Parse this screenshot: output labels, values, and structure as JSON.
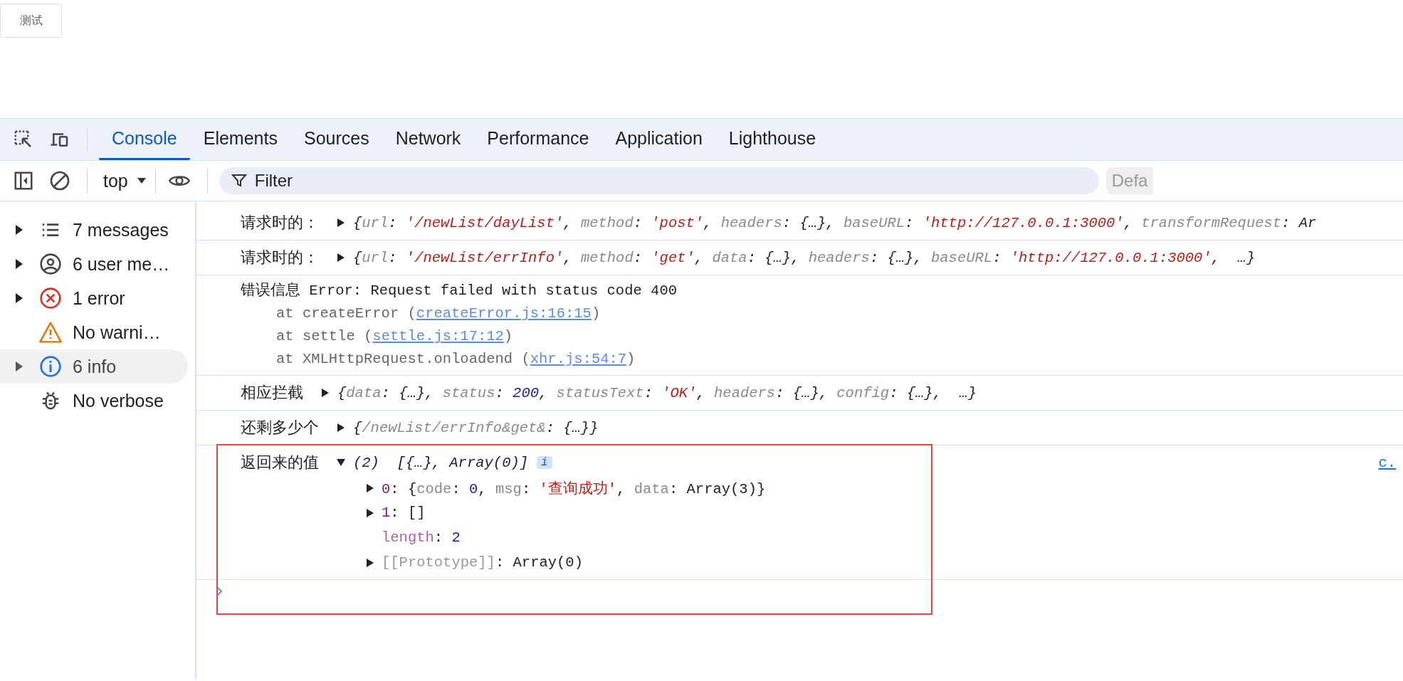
{
  "page_button": {
    "label": "测试"
  },
  "tabs": [
    {
      "label": "Console",
      "selected": true
    },
    {
      "label": "Elements",
      "selected": false
    },
    {
      "label": "Sources",
      "selected": false
    },
    {
      "label": "Network",
      "selected": false
    },
    {
      "label": "Performance",
      "selected": false
    },
    {
      "label": "Application",
      "selected": false
    },
    {
      "label": "Lighthouse",
      "selected": false
    }
  ],
  "toolbar": {
    "context": "top",
    "filter_placeholder": "Filter",
    "levels_button": "Defa"
  },
  "sidebar": {
    "items": [
      {
        "kind": "messages",
        "label": "7 messages",
        "expandable": true,
        "selected": false
      },
      {
        "kind": "user",
        "label": "6 user me…",
        "expandable": true,
        "selected": false
      },
      {
        "kind": "error",
        "label": "1 error",
        "expandable": true,
        "selected": false
      },
      {
        "kind": "warning",
        "label": "No warni…",
        "expandable": false,
        "selected": false
      },
      {
        "kind": "info",
        "label": "6 info",
        "expandable": true,
        "selected": true
      },
      {
        "kind": "verbose",
        "label": "No verbose",
        "expandable": false,
        "selected": false
      }
    ]
  },
  "messages": [
    {
      "kind": "object",
      "label": "请求时的：",
      "expanded": false,
      "highlighted": false,
      "preview": [
        {
          "kind": "punct",
          "s": "{"
        },
        {
          "kind": "key",
          "s": "url"
        },
        {
          "kind": "punct",
          "s": ": "
        },
        {
          "kind": "str",
          "s": "'/newList/dayList'"
        },
        {
          "kind": "punct",
          "s": ", "
        },
        {
          "kind": "key",
          "s": "method"
        },
        {
          "kind": "punct",
          "s": ": "
        },
        {
          "kind": "str",
          "s": "'post'"
        },
        {
          "kind": "punct",
          "s": ", "
        },
        {
          "kind": "key",
          "s": "headers"
        },
        {
          "kind": "punct",
          "s": ": {…}, "
        },
        {
          "kind": "key",
          "s": "baseURL"
        },
        {
          "kind": "punct",
          "s": ": "
        },
        {
          "kind": "str",
          "s": "'http://127.0.0.1:3000'"
        },
        {
          "kind": "punct",
          "s": ", "
        },
        {
          "kind": "key",
          "s": "transformRequest"
        },
        {
          "kind": "punct",
          "s": ": Ar"
        }
      ]
    },
    {
      "kind": "object",
      "label": "请求时的：",
      "expanded": false,
      "highlighted": false,
      "preview": [
        {
          "kind": "punct",
          "s": "{"
        },
        {
          "kind": "key",
          "s": "url"
        },
        {
          "kind": "punct",
          "s": ": "
        },
        {
          "kind": "str",
          "s": "'/newList/errInfo'"
        },
        {
          "kind": "punct",
          "s": ", "
        },
        {
          "kind": "key",
          "s": "method"
        },
        {
          "kind": "punct",
          "s": ": "
        },
        {
          "kind": "str",
          "s": "'get'"
        },
        {
          "kind": "punct",
          "s": ", "
        },
        {
          "kind": "key",
          "s": "data"
        },
        {
          "kind": "punct",
          "s": ": {…}, "
        },
        {
          "kind": "key",
          "s": "headers"
        },
        {
          "kind": "punct",
          "s": ": {…}, "
        },
        {
          "kind": "key",
          "s": "baseURL"
        },
        {
          "kind": "punct",
          "s": ": "
        },
        {
          "kind": "str",
          "s": "'http://127.0.0.1:3000'"
        },
        {
          "kind": "punct",
          "s": ",  …}"
        }
      ]
    },
    {
      "kind": "error",
      "text": "错误信息 Error: Request failed with status code 400",
      "stack": [
        {
          "before": "at createError (",
          "link": "createError.js:16:15",
          "after": ")"
        },
        {
          "before": "at settle (",
          "link": "settle.js:17:12",
          "after": ")"
        },
        {
          "before": "at XMLHttpRequest.onloadend (",
          "link": "xhr.js:54:7",
          "after": ")"
        }
      ]
    },
    {
      "kind": "object",
      "label": "相应拦截",
      "expanded": false,
      "highlighted": false,
      "preview": [
        {
          "kind": "punct",
          "s": "{"
        },
        {
          "kind": "key",
          "s": "data"
        },
        {
          "kind": "punct",
          "s": ": {…}, "
        },
        {
          "kind": "key",
          "s": "status"
        },
        {
          "kind": "punct",
          "s": ": "
        },
        {
          "kind": "num",
          "s": "200"
        },
        {
          "kind": "punct",
          "s": ", "
        },
        {
          "kind": "key",
          "s": "statusText"
        },
        {
          "kind": "punct",
          "s": ": "
        },
        {
          "kind": "str",
          "s": "'OK'"
        },
        {
          "kind": "punct",
          "s": ", "
        },
        {
          "kind": "key",
          "s": "headers"
        },
        {
          "kind": "punct",
          "s": ": {…}, "
        },
        {
          "kind": "key",
          "s": "config"
        },
        {
          "kind": "punct",
          "s": ": {…},  …}"
        }
      ]
    },
    {
      "kind": "object",
      "label": "还剩多少个",
      "expanded": false,
      "highlighted": false,
      "preview": [
        {
          "kind": "punct",
          "s": "{"
        },
        {
          "kind": "key",
          "s": "/newList/errInfo&get&"
        },
        {
          "kind": "punct",
          "s": ": {…}}"
        }
      ]
    },
    {
      "kind": "object",
      "label": "返回来的值",
      "expanded": true,
      "highlighted": true,
      "source": "c.",
      "preview": [
        {
          "kind": "punct",
          "s": "(2)  [{…}, Array(0)]"
        }
      ],
      "badge": "i",
      "children": [
        {
          "kind": "expandable",
          "parts": [
            {
              "kind": "index",
              "s": "0"
            },
            {
              "kind": "punct",
              "s": ": {"
            },
            {
              "kind": "key",
              "s": "code"
            },
            {
              "kind": "punct",
              "s": ": "
            },
            {
              "kind": "num",
              "s": "0"
            },
            {
              "kind": "punct",
              "s": ", "
            },
            {
              "kind": "key",
              "s": "msg"
            },
            {
              "kind": "punct",
              "s": ": "
            },
            {
              "kind": "str",
              "s": "'查询成功'"
            },
            {
              "kind": "punct",
              "s": ", "
            },
            {
              "kind": "key",
              "s": "data"
            },
            {
              "kind": "punct",
              "s": ": Array(3)}"
            }
          ]
        },
        {
          "kind": "expandable",
          "parts": [
            {
              "kind": "index",
              "s": "1"
            },
            {
              "kind": "punct",
              "s": ": []"
            }
          ]
        },
        {
          "kind": "plain",
          "parts": [
            {
              "kind": "own",
              "s": "length"
            },
            {
              "kind": "punct",
              "s": ": "
            },
            {
              "kind": "num",
              "s": "2"
            }
          ]
        },
        {
          "kind": "expandable",
          "parts": [
            {
              "kind": "internal",
              "s": "[[Prototype]]"
            },
            {
              "kind": "punct",
              "s": ": Array(0)"
            }
          ]
        }
      ]
    }
  ]
}
